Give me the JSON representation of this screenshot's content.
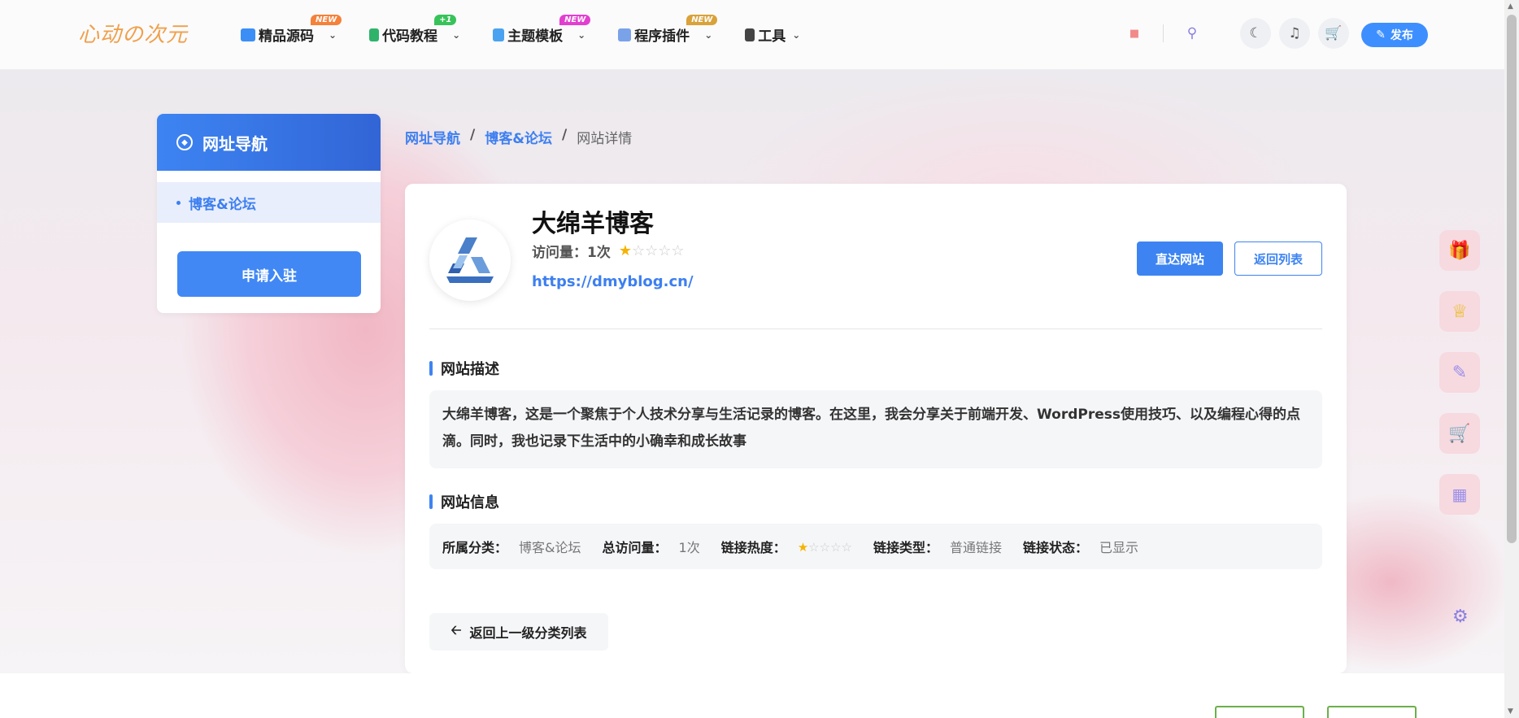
{
  "header": {
    "logo": "心动の次元",
    "nav": [
      {
        "label": "精品源码",
        "badge": "NEW",
        "badge_color": "#f5813a",
        "icon_color": "#3a8ef5"
      },
      {
        "label": "代码教程",
        "badge": "+1",
        "badge_color": "#37c35a",
        "icon_color": "#2fb36a"
      },
      {
        "label": "主题模板",
        "badge": "NEW",
        "badge_color": "#e23fd0",
        "icon_color": "#4aa3f0"
      },
      {
        "label": "程序插件",
        "badge": "NEW",
        "badge_color": "#d9a23a",
        "icon_color": "#7aa2e8"
      },
      {
        "label": "工具",
        "badge": "",
        "badge_color": "",
        "icon_color": "#444"
      }
    ],
    "publish_label": "发布"
  },
  "sidebar": {
    "title": "网址导航",
    "items": [
      {
        "label": "博客&论坛"
      }
    ],
    "apply_label": "申请入驻"
  },
  "breadcrumb": {
    "items": [
      "网址导航",
      "博客&论坛",
      "网站详情"
    ]
  },
  "site": {
    "title": "大绵羊博客",
    "visits_label": "访问量：1次",
    "rating": 1,
    "rating_max": 5,
    "url": "https://dmyblog.cn/",
    "go_label": "直达网站",
    "back_label": "返回列表"
  },
  "description": {
    "title": "网站描述",
    "text": "大绵羊博客，这是一个聚焦于个人技术分享与生活记录的博客。在这里，我会分享关于前端开发、WordPress使用技巧、以及编程心得的点滴。同时，我也记录下生活中的小确幸和成长故事"
  },
  "info": {
    "title": "网站信息",
    "category_key": "所属分类：",
    "category_value": "博客&论坛",
    "visits_key": "总访问量：",
    "visits_value": "1次",
    "heat_key": "链接热度：",
    "heat_rating": 1,
    "type_key": "链接类型：",
    "type_value": "普通链接",
    "status_key": "链接状态：",
    "status_value": "已显示"
  },
  "back_up_label": "返回上一级分类列表"
}
